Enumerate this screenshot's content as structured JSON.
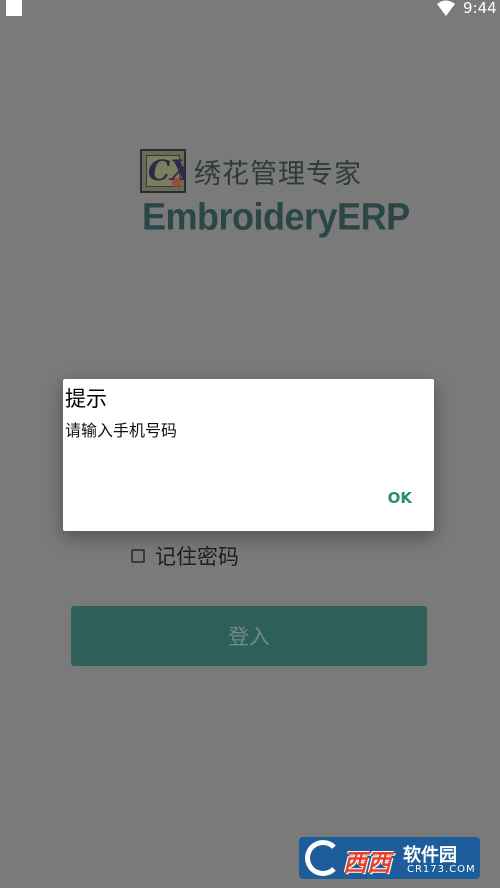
{
  "status_bar": {
    "time": "9:44",
    "icons": [
      "notification-square-icon",
      "wifi-icon"
    ]
  },
  "logo": {
    "mark_letters": "CX",
    "cn_title": "绣花管理专家",
    "en_title": "EmbroideryERP"
  },
  "form": {
    "remember_label": "记住密码",
    "remember_checked": false,
    "login_label": "登入"
  },
  "dialog": {
    "title": "提示",
    "message": "请输入手机号码",
    "ok_label": "OK"
  },
  "watermark": {
    "red_text": "西西",
    "text": "软件园",
    "url": "CR173.COM"
  },
  "colors": {
    "overlay_background": "#7a7a7a",
    "button": "#2f5f59",
    "accent": "#2b8a74",
    "dialog_background": "#ffffff"
  }
}
